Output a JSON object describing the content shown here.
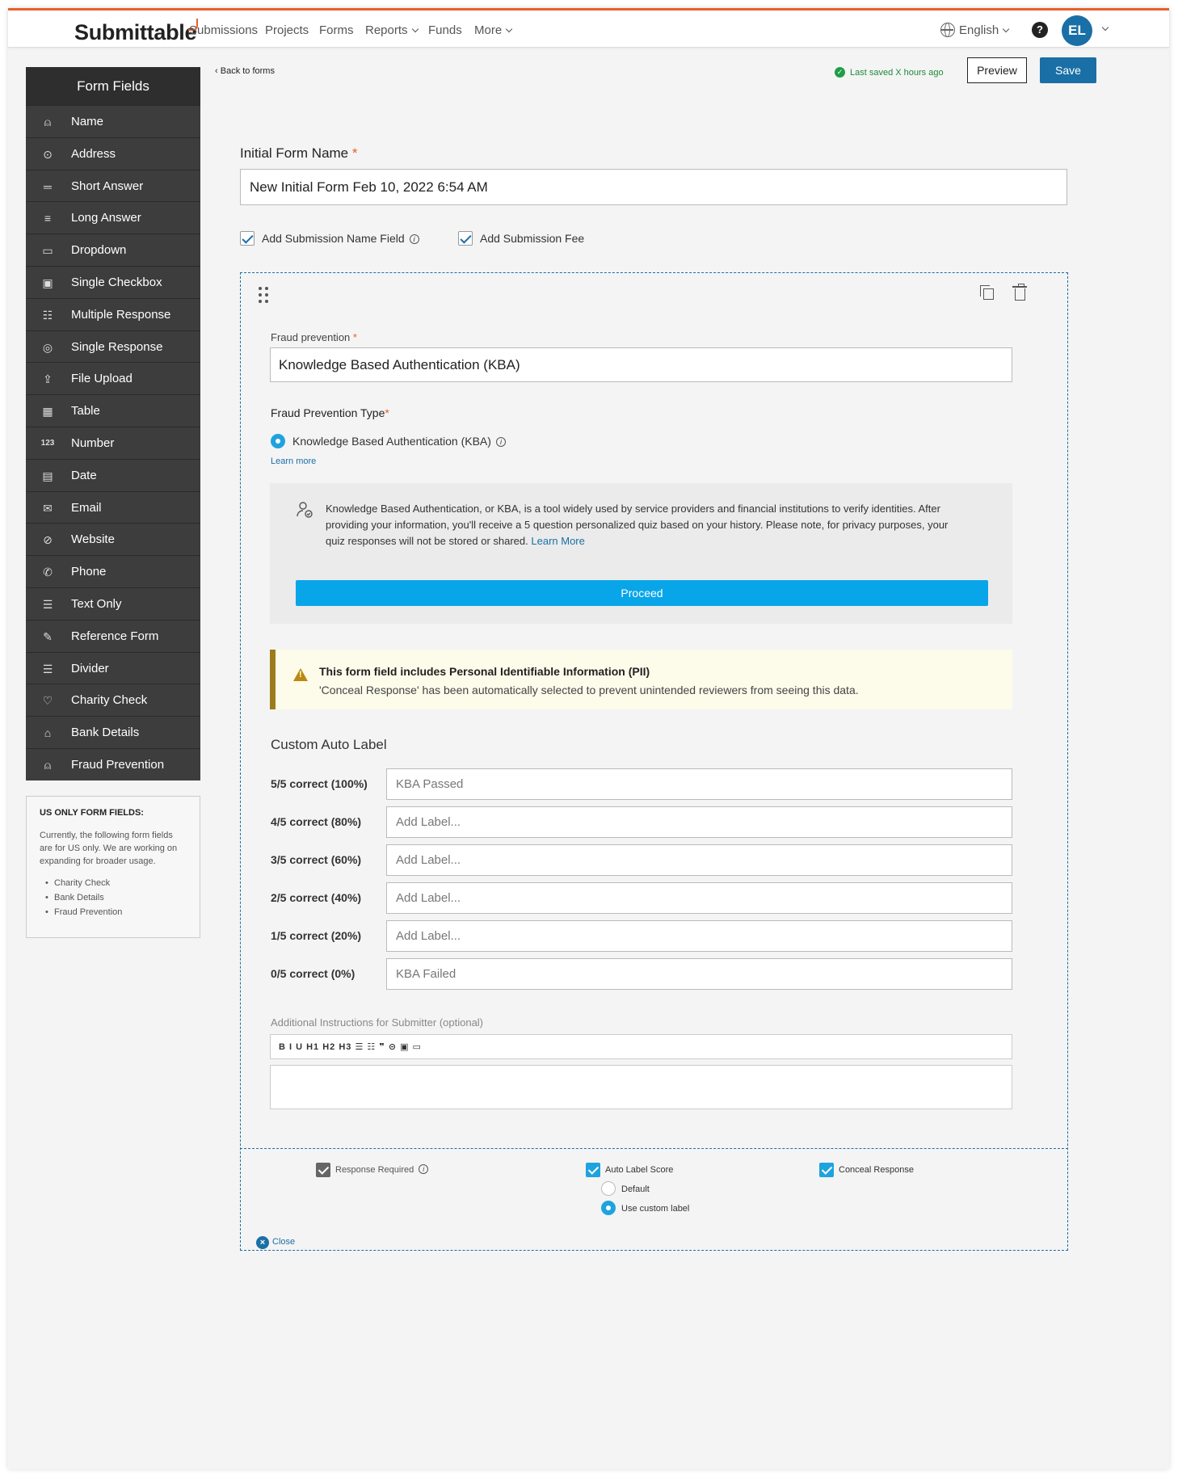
{
  "header": {
    "logo": "Submittable",
    "nav": [
      {
        "label": "Submissions",
        "dropdown": false
      },
      {
        "label": "Projects",
        "dropdown": false
      },
      {
        "label": "Forms",
        "dropdown": false
      },
      {
        "label": "Reports",
        "dropdown": true
      },
      {
        "label": "Funds",
        "dropdown": false
      },
      {
        "label": "More",
        "dropdown": true
      }
    ],
    "language": "English",
    "help": "?",
    "avatar": "EL",
    "accent_color": "#e8602c"
  },
  "sidebar": {
    "title": "Form Fields",
    "items": [
      {
        "label": "Name",
        "icon": "person-icon"
      },
      {
        "label": "Address",
        "icon": "map-pin-icon"
      },
      {
        "label": "Short Answer",
        "icon": "short-lines-icon"
      },
      {
        "label": "Long Answer",
        "icon": "long-lines-icon"
      },
      {
        "label": "Dropdown",
        "icon": "dropdown-icon"
      },
      {
        "label": "Single Checkbox",
        "icon": "checkbox-icon"
      },
      {
        "label": "Multiple Response",
        "icon": "multi-checkbox-icon"
      },
      {
        "label": "Single Response",
        "icon": "radio-list-icon"
      },
      {
        "label": "File Upload",
        "icon": "upload-icon"
      },
      {
        "label": "Table",
        "icon": "table-icon"
      },
      {
        "label": "Number",
        "icon": "number-icon"
      },
      {
        "label": "Date",
        "icon": "calendar-icon"
      },
      {
        "label": "Email",
        "icon": "envelope-icon"
      },
      {
        "label": "Website",
        "icon": "link-icon"
      },
      {
        "label": "Phone",
        "icon": "phone-icon"
      },
      {
        "label": "Text Only",
        "icon": "text-lock-icon"
      },
      {
        "label": "Reference Form",
        "icon": "pen-icon"
      },
      {
        "label": "Divider",
        "icon": "divider-icon"
      },
      {
        "label": "Charity Check",
        "icon": "hand-heart-icon"
      },
      {
        "label": "Bank Details",
        "icon": "bank-icon"
      },
      {
        "label": "Fraud Prevention",
        "icon": "person-check-icon"
      }
    ],
    "us_only": {
      "title": "US ONLY FORM FIELDS:",
      "text": "Currently, the following form fields are for US only. We are working on expanding for broader usage.",
      "items": [
        "Charity Check",
        "Bank Details",
        "Fraud Prevention"
      ]
    }
  },
  "toolbar": {
    "back": "Back to forms",
    "saved": "Last saved X hours ago",
    "preview": "Preview",
    "save": "Save"
  },
  "form": {
    "name_label": "Initial Form Name",
    "name_value": "New Initial Form Feb 10, 2022 6:54 AM",
    "add_name_field": "Add Submission Name Field",
    "add_fee": "Add Submission Fee"
  },
  "field": {
    "title_label": "Fraud prevention",
    "title_value": "Knowledge Based Authentication (KBA)",
    "type_label": "Fraud Prevention Type",
    "type_option": "Knowledge Based Authentication (KBA)",
    "learn_more": "Learn more",
    "kba_text": "Knowledge Based Authentication, or KBA, is a tool widely used by service providers and financial institutions to verify identities. After providing your information, you'll receive a 5 question personalized quiz based on your history. Please note, for privacy purposes, your quiz responses will not be stored or shared.",
    "kba_link": "Learn More",
    "proceed": "Proceed",
    "warn_title": "This form field includes Personal Identifiable Information (PII)",
    "warn_text": "'Conceal Response' has been automatically selected to prevent unintended reviewers from seeing this data.",
    "custom_label_title": "Custom Auto Label",
    "labels": [
      {
        "score": "5/5 correct (100%)",
        "value": "KBA Passed"
      },
      {
        "score": "4/5 correct (80%)",
        "value": "Add Label..."
      },
      {
        "score": "3/5 correct (60%)",
        "value": "Add Label..."
      },
      {
        "score": "2/5 correct (40%)",
        "value": "Add Label..."
      },
      {
        "score": "1/5 correct (20%)",
        "value": "Add Label..."
      },
      {
        "score": "0/5 correct (0%)",
        "value": "KBA Failed"
      }
    ],
    "instructions_label": "Additional Instructions for Submitter (optional)",
    "rte_tools": "B  I  U  H1 H2 H3  ☰  ☷  ❞  ⊝  ▣  ▭",
    "options": {
      "response_required": "Response Required",
      "auto_label_score": "Auto Label Score",
      "default": "Default",
      "use_custom": "Use custom label",
      "conceal": "Conceal Response"
    },
    "close": "Close"
  }
}
